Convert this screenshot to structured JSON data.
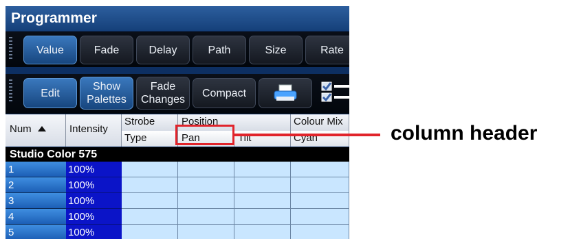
{
  "window": {
    "title": "Programmer"
  },
  "toolbar1": [
    {
      "label": "Value",
      "selected": true
    },
    {
      "label": "Fade",
      "selected": false
    },
    {
      "label": "Delay",
      "selected": false
    },
    {
      "label": "Path",
      "selected": false
    },
    {
      "label": "Size",
      "selected": false
    },
    {
      "label": "Rate",
      "selected": false
    }
  ],
  "toolbar2": {
    "edit": "Edit",
    "show_palettes_line1": "Show",
    "show_palettes_line2": "Palettes",
    "fade_changes_line1": "Fade",
    "fade_changes_line2": "Changes",
    "compact": "Compact",
    "print_icon": "printer-icon",
    "check_icon": "checklist-icon"
  },
  "grid": {
    "headers": {
      "num": "Num",
      "num_sort_icon": "sort-ascending-icon",
      "intensity": "Intensity",
      "strobe_line1": "Strobe",
      "strobe_line2": "Type",
      "position": "Position",
      "pan": "Pan",
      "tilt": "Tilt",
      "colour_mix": "Colour Mix",
      "cyan": "Cyan"
    },
    "group": "Studio Color 575",
    "rows": [
      {
        "num": "1",
        "intensity": "100%"
      },
      {
        "num": "2",
        "intensity": "100%"
      },
      {
        "num": "3",
        "intensity": "100%"
      },
      {
        "num": "4",
        "intensity": "100%"
      },
      {
        "num": "5",
        "intensity": "100%"
      }
    ]
  },
  "callout": {
    "label": "column header",
    "color": "#e1242b"
  }
}
